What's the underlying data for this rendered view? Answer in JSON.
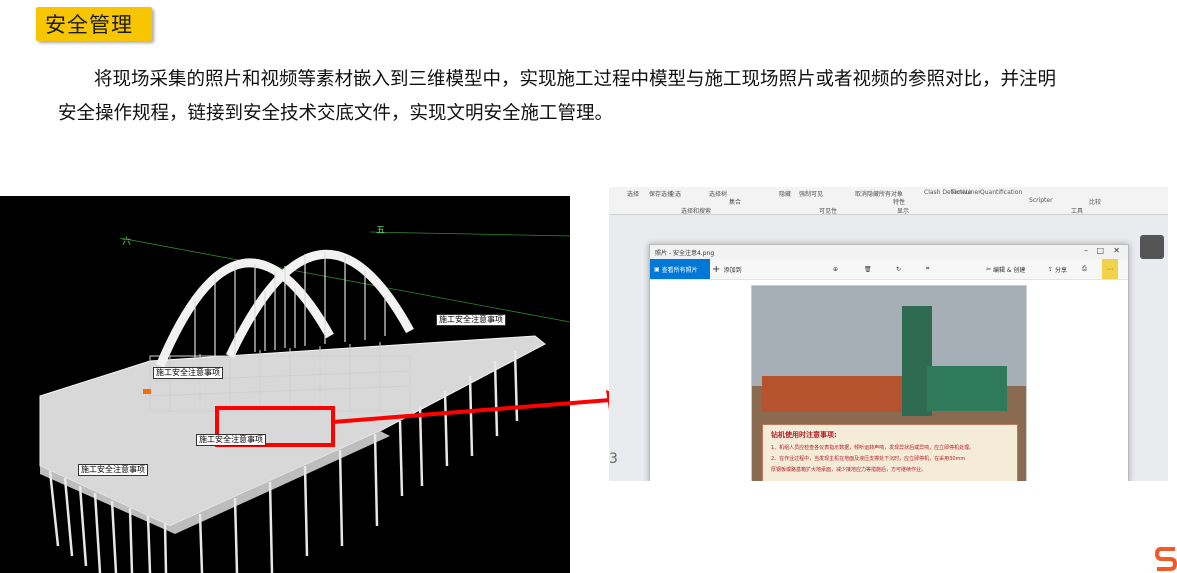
{
  "header": {
    "title": "安全管理"
  },
  "body": {
    "line1": "将现场采集的照片和视频等素材嵌入到三维模型中，实现施工过程中模型与施工现场照片或者视频的参照对比，并注明",
    "line2": "安全操作规程，链接到安全技术交底文件，实现文明安全施工管理。"
  },
  "scene": {
    "grid_labels": [
      "六",
      "五"
    ],
    "safety_label": "施工安全注意事项"
  },
  "ribbon": {
    "groups": [
      "选择和搜索",
      "可见性",
      "显示",
      "工具"
    ],
    "items": [
      "选择",
      "保存选择",
      "全选",
      "选择相同对象",
      "选择树",
      "集合",
      "隐藏",
      "强制可见",
      "隐藏未选定对象",
      "取消隐藏所有对象",
      "链接",
      "特性",
      "Clash Detective",
      "TimeLiner",
      "Quantification",
      "Scripter",
      "比较"
    ]
  },
  "photo_window": {
    "title": "照片 - 安全注意4.png",
    "see_all": "查看所有照片",
    "add": "添加到",
    "edit_create": "编辑 & 创建",
    "share": "分享",
    "notice_title": "钻机使用时注意事项:",
    "notice_1": "1、机组人员应检查各仪表指示数据，倾听运转声响，发现异状后或异响，应立即停机处理。",
    "notice_2": "2、在作业过程中，当发现主机在地面及液压支撑处下沉时，应立即停机，在采用30mm",
    "notice_3": "厚钢板或路基箱扩大地承面，减少接地应力等措施后，方可继续作业。",
    "page_num": "3"
  },
  "colors": {
    "accent": "#f7c600",
    "arrow": "#ff0000",
    "brand": "#0078d7"
  }
}
